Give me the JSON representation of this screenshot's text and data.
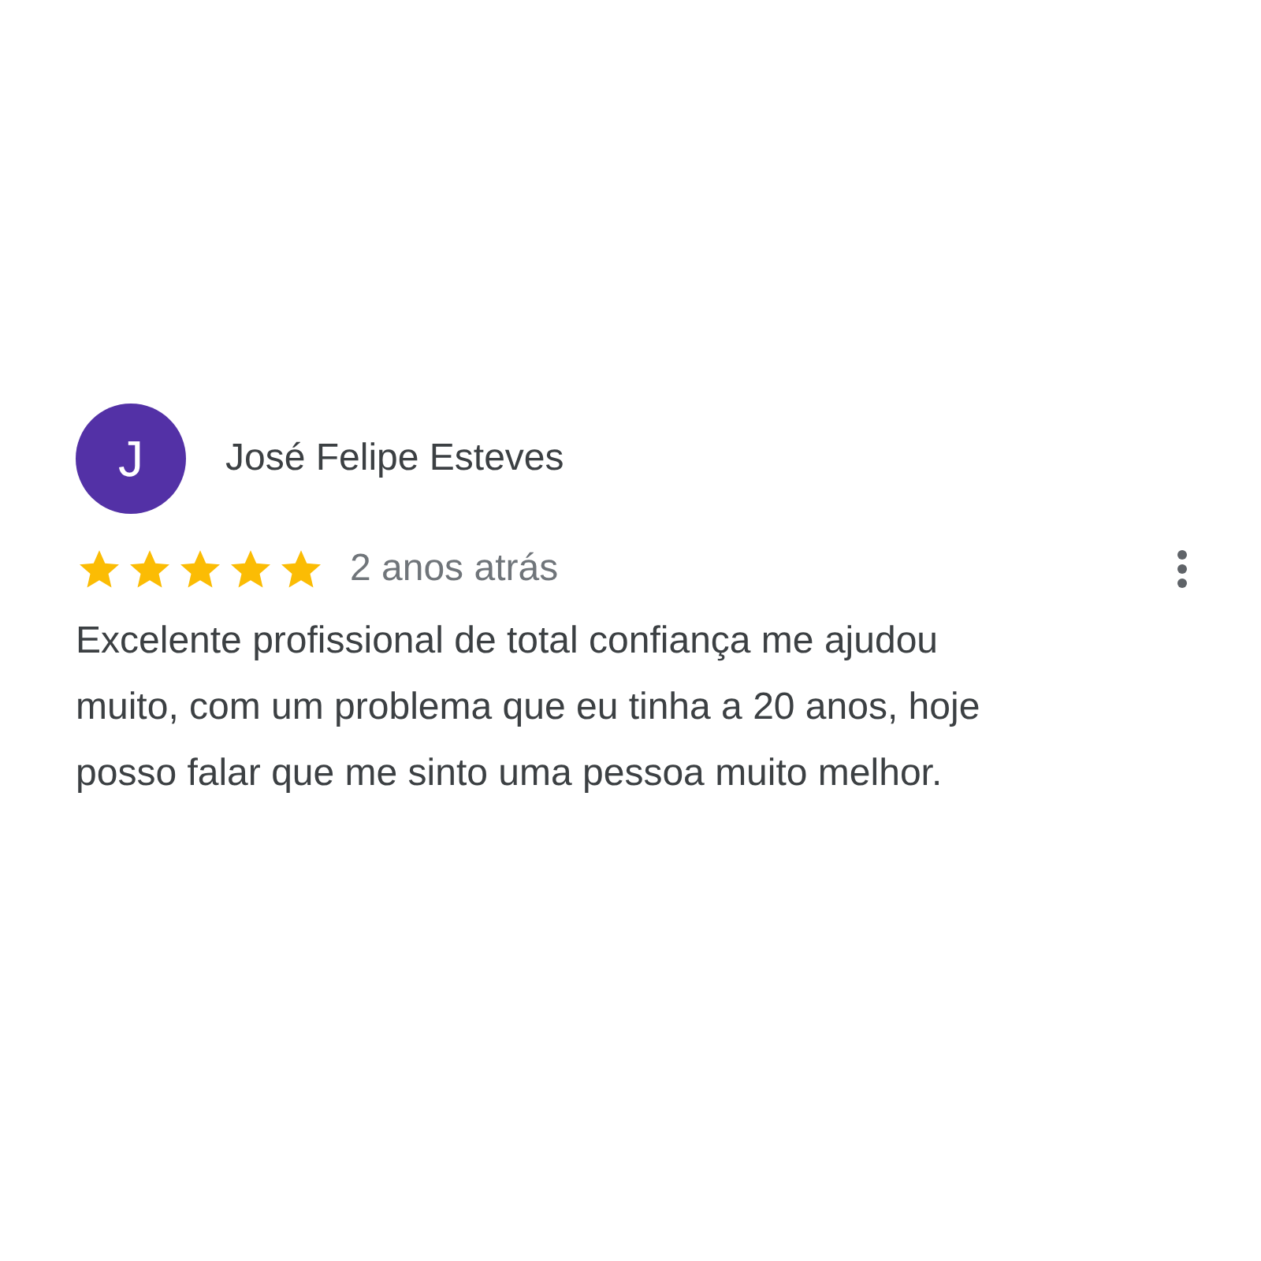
{
  "review": {
    "avatar_letter": "J",
    "author": "José Felipe Esteves",
    "stars": 5,
    "time": "2 anos atrás",
    "text": "Excelente profissional de total confiança me ajudou muito, com um problema que eu tinha a 20 anos, hoje posso falar que me sinto uma pessoa muito melhor."
  }
}
